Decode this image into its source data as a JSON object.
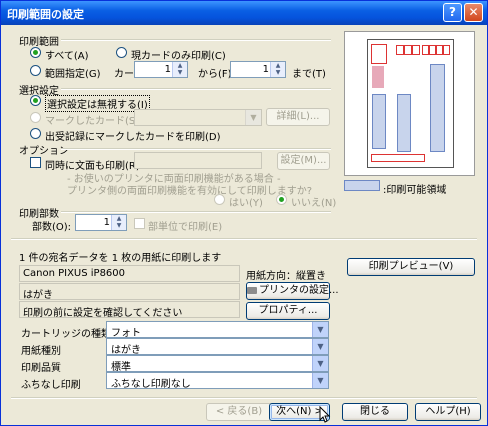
{
  "window": {
    "title": "印刷範囲の設定",
    "help_icon": "?",
    "close_icon": "✕"
  },
  "print_range": {
    "header": "印刷範囲",
    "all": "すべて(A)",
    "current_only": "現カードのみ印刷(C)",
    "range": "範囲指定(G)",
    "card_label": "カード",
    "from_value": "1",
    "from_label": "から(F)",
    "to_value": "1",
    "to_label": "まで(T)"
  },
  "selection": {
    "header": "選択設定",
    "ignore": "選択設定は無視する(I)",
    "marked": "マークしたカード(S)",
    "detail_button": "詳細(L)...",
    "sent_received": "出受記録にマークしたカードを印刷(D)"
  },
  "options": {
    "header": "オプション",
    "print_message": "同時に文面も印刷(R)",
    "settings_button": "設定(M)...",
    "note1": "- お使いのプリンタに両面印刷機能がある場合 -",
    "note2": "プリンタ側の両面印刷機能を有効にして印刷しますか?",
    "yes": "はい(Y)",
    "no": "いいえ(N)"
  },
  "copies": {
    "header": "印刷部数",
    "label": "部数(O):",
    "value": "1",
    "collate": "部単位で印刷(E)"
  },
  "summary": "1 件の宛名データを 1 枚の用紙に印刷します",
  "printer": {
    "name": "Canon PIXUS iP8600",
    "paper": "はがき",
    "confirm": "印刷の前に設定を確認してください",
    "orientation": "用紙方向：縦置き",
    "printer_settings_button": "プリンタの設定...",
    "properties_button": "プロパティ..."
  },
  "dropdowns": [
    {
      "label": "カートリッジの種類",
      "value": "フォト"
    },
    {
      "label": "用紙種別",
      "value": "はがき"
    },
    {
      "label": "印刷品質",
      "value": "標準"
    },
    {
      "label": "ふちなし印刷",
      "value": "ふちなし印刷なし"
    }
  ],
  "preview": {
    "legend": ":印刷可能領域",
    "button": "印刷プレビュー(V)"
  },
  "footer": {
    "back": "< 戻る(B)",
    "next": "次へ(N) >",
    "close": "閉じる",
    "help": "ヘルプ(H)"
  }
}
